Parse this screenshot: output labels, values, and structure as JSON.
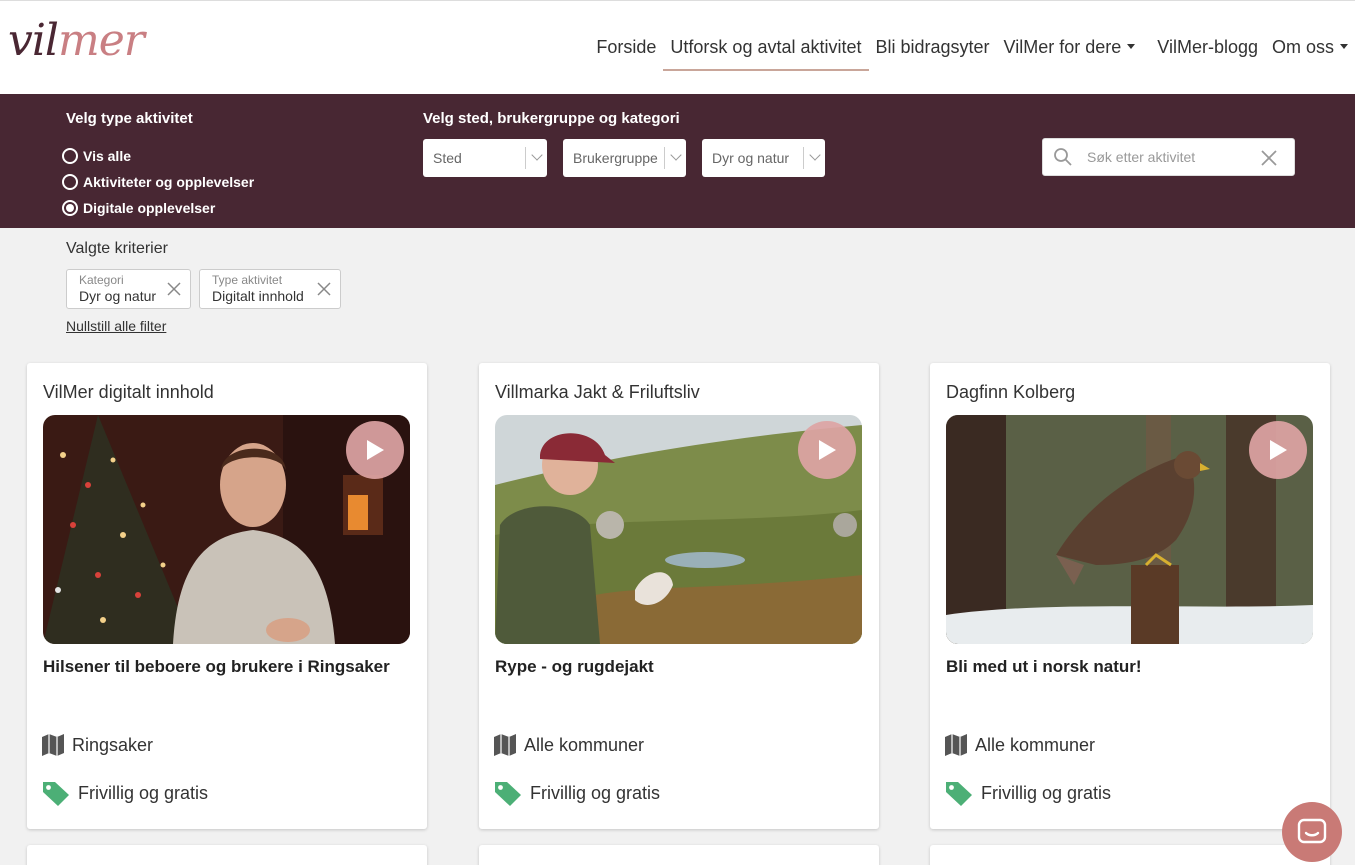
{
  "brand": {
    "logo_part1": "vil",
    "logo_part2": "mer"
  },
  "nav": [
    {
      "label": "Forside"
    },
    {
      "label": "Utforsk og avtal aktivitet"
    },
    {
      "label": "Bli bidragsyter"
    },
    {
      "label": "VilMer for dere"
    },
    {
      "label": "VilMer-blogg"
    },
    {
      "label": "Om oss"
    }
  ],
  "filters": {
    "type_heading": "Velg type aktivitet",
    "radios": [
      {
        "label": "Vis alle",
        "checked": false
      },
      {
        "label": "Aktiviteter og opplevelser",
        "checked": false
      },
      {
        "label": "Digitale opplevelser",
        "checked": true
      }
    ],
    "place_heading": "Velg sted, brukergruppe og kategori",
    "selects": [
      {
        "value": "Sted"
      },
      {
        "value": "Brukergruppe"
      },
      {
        "value": "Dyr og natur"
      }
    ],
    "search_placeholder": "Søk etter aktivitet"
  },
  "criteria": {
    "label": "Valgte kriterier",
    "chips": [
      {
        "key": "Kategori",
        "value": "Dyr og natur"
      },
      {
        "key": "Type aktivitet",
        "value": "Digitalt innhold"
      }
    ],
    "reset_label": "Nullstill alle filter"
  },
  "cards": [
    {
      "provider": "VilMer digitalt innhold",
      "title": "Hilsener til beboere og brukere i Ringsaker",
      "location": "Ringsaker",
      "price": "Frivillig og gratis"
    },
    {
      "provider": "Villmarka Jakt & Friluftsliv",
      "title": "Rype - og rugdejakt",
      "location": "Alle kommuner",
      "price": "Frivillig og gratis"
    },
    {
      "provider": "Dagfinn Kolberg",
      "title": "Bli med ut i norsk natur!",
      "location": "Alle kommuner",
      "price": "Frivillig og gratis"
    }
  ],
  "colors": {
    "brand_dark": "#482733",
    "brand_rose": "#c97f83",
    "tag_green": "#4caf76",
    "play": "#dda4a4"
  },
  "icons": {
    "map": "map-icon",
    "tag": "tag-icon",
    "play": "play-icon",
    "search": "search-icon",
    "chat": "chat-icon"
  }
}
